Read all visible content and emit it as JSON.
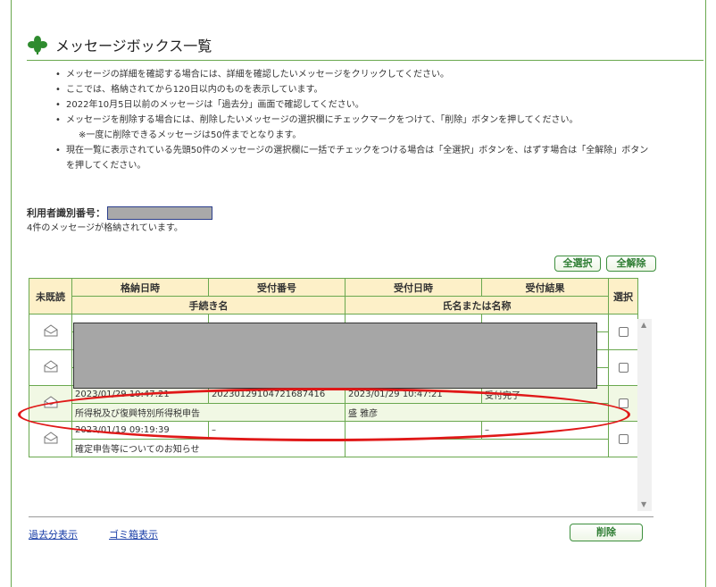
{
  "page": {
    "title": "メッセージボックス一覧"
  },
  "notes": [
    "メッセージの詳細を確認する場合には、詳細を確認したいメッセージをクリックしてください。",
    "ここでは、格納されてから120日以内のものを表示しています。",
    "2022年10月5日以前のメッセージは「過去分」画面で確認してください。",
    "メッセージを削除する場合には、削除したいメッセージの選択欄にチェックマークをつけて、「削除」ボタンを押してください。",
    "※一度に削除できるメッセージは50件までとなります。",
    "現在一覧に表示されている先頭50件のメッセージの選択欄に一括でチェックをつける場合は「全選択」ボタンを、はずす場合は「全解除」ボタン",
    "を押してください。"
  ],
  "user": {
    "id_label": "利用者識別番号：",
    "count_text": "4件のメッセージが格納されています。"
  },
  "buttons": {
    "select_all": "全選択",
    "deselect_all": "全解除",
    "delete": "削除"
  },
  "table": {
    "headers": {
      "unread": "未既読",
      "stored_at": "格納日時",
      "receipt_no": "受付番号",
      "received_at": "受付日時",
      "result": "受付結果",
      "select": "選択",
      "procedure": "手続き名",
      "name": "氏名または名称"
    },
    "rows": [
      {
        "stored_at": "2023/01/29 10:47:21",
        "receipt_no": "20230129104721687416",
        "received_at": "2023/01/29 10:47:21",
        "result": "受付完了",
        "procedure": "所得税及び復興特別所得税申告",
        "name": "盛 雅彦"
      },
      {
        "stored_at": "2023/01/19 09:19:39",
        "receipt_no": "–",
        "received_at": "",
        "result": "–",
        "procedure": "確定申告等についてのお知らせ",
        "name": ""
      }
    ]
  },
  "links": {
    "past": "過去分表示",
    "trash": "ゴミ箱表示"
  },
  "icons": {
    "title": "clover-icon",
    "envelope": "envelope-icon"
  },
  "colors": {
    "accent": "#6aa84f",
    "header_bg": "#fdf0c8",
    "highlight": "#e01818"
  }
}
